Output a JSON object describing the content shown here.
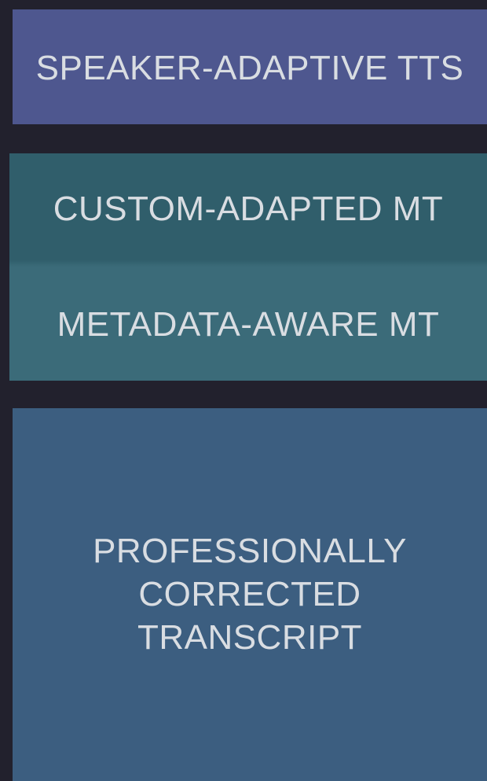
{
  "layers": {
    "tts": {
      "label": "SPEAKER-ADAPTIVE TTS",
      "color": "#4e578f"
    },
    "mt_custom": {
      "label": "CUSTOM-ADAPTED MT",
      "color": "#305e6b"
    },
    "mt_metadata": {
      "label": "METADATA-AWARE MT",
      "color": "#3b6b79"
    },
    "transcript": {
      "label": "PROFESSIONALLY\nCORRECTED\nTRANSCRIPT",
      "color": "#3c5e80"
    }
  },
  "background_color": "#22212d",
  "text_color": "#d9dde2"
}
